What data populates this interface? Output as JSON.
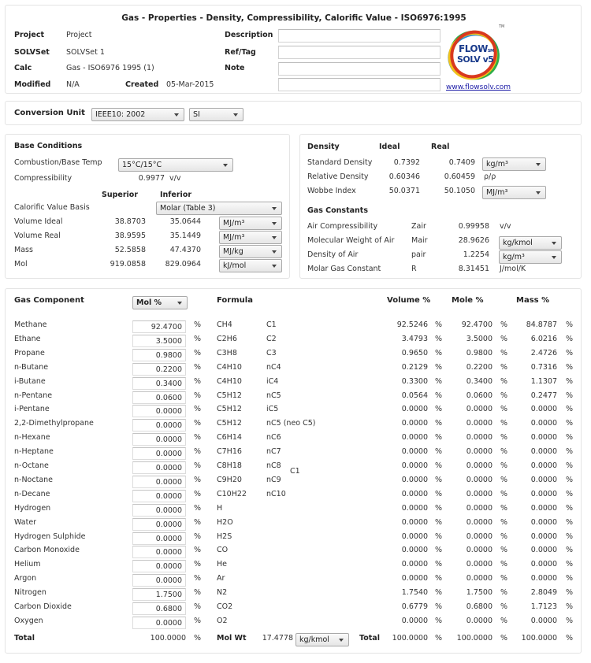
{
  "header": {
    "title": "Gas - Properties - Density, Compressibility, Calorific Value - ISO6976:1995",
    "project_label": "Project",
    "project_value": "Project",
    "solvset_label": "SOLVSet",
    "solvset_value": "SOLVSet 1",
    "calc_label": "Calc",
    "calc_value": "Gas - ISO6976 1995 (1)",
    "modified_label": "Modified",
    "modified_value": "N/A",
    "created_label": "Created",
    "created_value": "05-Mar-2015",
    "description_label": "Description",
    "description_value": "",
    "reftag_label": "Ref/Tag",
    "reftag_value": "",
    "note_label": "Note",
    "note_value": "",
    "extra_value": "",
    "logo_line1": "FLOW",
    "logo_sm": "SM",
    "logo_line2": "SOLV v5",
    "logo_tm": "TM",
    "website": "www.flowsolv.com"
  },
  "conversion": {
    "label": "Conversion Unit",
    "standard": "IEEE10: 2002",
    "system": "SI"
  },
  "base_conditions": {
    "title": "Base Conditions",
    "temp_label": "Combustion/Base Temp",
    "temp_value": "15°C/15°C",
    "compress_label": "Compressibility",
    "compress_value": "0.9977",
    "compress_unit": "v/v",
    "superior_header": "Superior",
    "inferior_header": "Inferior",
    "basis_label": "Calorific Value Basis",
    "basis_value": "Molar (Table 3)",
    "rows": [
      {
        "label": "Volume Ideal",
        "superior": "38.8703",
        "inferior": "35.0644",
        "unit": "MJ/m³"
      },
      {
        "label": "Volume Real",
        "superior": "38.9595",
        "inferior": "35.1449",
        "unit": "MJ/m³"
      },
      {
        "label": "Mass",
        "superior": "52.5858",
        "inferior": "47.4370",
        "unit": "MJ/kg"
      },
      {
        "label": "Mol",
        "superior": "919.0858",
        "inferior": "829.0964",
        "unit": "kJ/mol"
      }
    ]
  },
  "density": {
    "title": "Density",
    "ideal_header": "Ideal",
    "real_header": "Real",
    "rows": [
      {
        "label": "Standard Density",
        "ideal": "0.7392",
        "real": "0.7409",
        "unit": "kg/m³",
        "unit_select": true
      },
      {
        "label": "Relative Density",
        "ideal": "0.60346",
        "real": "0.60459",
        "unit": "ρ/ρ",
        "unit_select": false
      },
      {
        "label": "Wobbe Index",
        "ideal": "50.0371",
        "real": "50.1050",
        "unit": "MJ/m³",
        "unit_select": true
      }
    ]
  },
  "gas_constants": {
    "title": "Gas Constants",
    "rows": [
      {
        "label": "Air Compressibility",
        "symbol": "Zair",
        "value": "0.99958",
        "unit": "v/v"
      },
      {
        "label": "Molecular Weight of Air",
        "symbol": "Mair",
        "value": "28.9626",
        "unit": "kg/kmol"
      },
      {
        "label": "Density of Air",
        "symbol": "pair",
        "value": "1.2254",
        "unit": "kg/m³"
      },
      {
        "label": "Molar Gas Constant",
        "symbol": "R",
        "value": "8.31451",
        "unit": "J/mol/K"
      }
    ]
  },
  "components": {
    "title": "Gas Component",
    "basis": "Mol %",
    "formula_header": "Formula",
    "volume_header": "Volume %",
    "mole_header": "Mole %",
    "mass_header": "Mass %",
    "pct": "%",
    "group_label": "C1",
    "rows": [
      {
        "name": "Methane",
        "input": "92.4700",
        "formula": "CH4",
        "short": "C1",
        "volume": "92.5246",
        "mole": "92.4700",
        "mass": "84.8787"
      },
      {
        "name": "Ethane",
        "input": "3.5000",
        "formula": "C2H6",
        "short": "C2",
        "volume": "3.4793",
        "mole": "3.5000",
        "mass": "6.0216"
      },
      {
        "name": "Propane",
        "input": "0.9800",
        "formula": "C3H8",
        "short": "C3",
        "volume": "0.9650",
        "mole": "0.9800",
        "mass": "2.4726"
      },
      {
        "name": "n-Butane",
        "input": "0.2200",
        "formula": "C4H10",
        "short": "nC4",
        "volume": "0.2129",
        "mole": "0.2200",
        "mass": "0.7316"
      },
      {
        "name": "i-Butane",
        "input": "0.3400",
        "formula": "C4H10",
        "short": "iC4",
        "volume": "0.3300",
        "mole": "0.3400",
        "mass": "1.1307"
      },
      {
        "name": "n-Pentane",
        "input": "0.0600",
        "formula": "C5H12",
        "short": "nC5",
        "volume": "0.0564",
        "mole": "0.0600",
        "mass": "0.2477"
      },
      {
        "name": "i-Pentane",
        "input": "0.0000",
        "formula": "C5H12",
        "short": "iC5",
        "volume": "0.0000",
        "mole": "0.0000",
        "mass": "0.0000"
      },
      {
        "name": "2,2-Dimethylpropane",
        "input": "0.0000",
        "formula": "C5H12",
        "short": "nC5 (neo C5)",
        "volume": "0.0000",
        "mole": "0.0000",
        "mass": "0.0000"
      },
      {
        "name": "n-Hexane",
        "input": "0.0000",
        "formula": "C6H14",
        "short": "nC6",
        "volume": "0.0000",
        "mole": "0.0000",
        "mass": "0.0000"
      },
      {
        "name": "n-Heptane",
        "input": "0.0000",
        "formula": "C7H16",
        "short": "nC7",
        "volume": "0.0000",
        "mole": "0.0000",
        "mass": "0.0000"
      },
      {
        "name": "n-Octane",
        "input": "0.0000",
        "formula": "C8H18",
        "short": "nC8",
        "volume": "0.0000",
        "mole": "0.0000",
        "mass": "0.0000"
      },
      {
        "name": "n-Noctane",
        "input": "0.0000",
        "formula": "C9H20",
        "short": "nC9",
        "volume": "0.0000",
        "mole": "0.0000",
        "mass": "0.0000"
      },
      {
        "name": "n-Decane",
        "input": "0.0000",
        "formula": "C10H22",
        "short": "nC10",
        "volume": "0.0000",
        "mole": "0.0000",
        "mass": "0.0000"
      },
      {
        "name": "Hydrogen",
        "input": "0.0000",
        "formula": "H",
        "short": "",
        "volume": "0.0000",
        "mole": "0.0000",
        "mass": "0.0000"
      },
      {
        "name": "Water",
        "input": "0.0000",
        "formula": "H2O",
        "short": "",
        "volume": "0.0000",
        "mole": "0.0000",
        "mass": "0.0000"
      },
      {
        "name": "Hydrogen Sulphide",
        "input": "0.0000",
        "formula": "H2S",
        "short": "",
        "volume": "0.0000",
        "mole": "0.0000",
        "mass": "0.0000"
      },
      {
        "name": "Carbon Monoxide",
        "input": "0.0000",
        "formula": "CO",
        "short": "",
        "volume": "0.0000",
        "mole": "0.0000",
        "mass": "0.0000"
      },
      {
        "name": "Helium",
        "input": "0.0000",
        "formula": "He",
        "short": "",
        "volume": "0.0000",
        "mole": "0.0000",
        "mass": "0.0000"
      },
      {
        "name": "Argon",
        "input": "0.0000",
        "formula": "Ar",
        "short": "",
        "volume": "0.0000",
        "mole": "0.0000",
        "mass": "0.0000"
      },
      {
        "name": "Nitrogen",
        "input": "1.7500",
        "formula": "N2",
        "short": "",
        "volume": "1.7540",
        "mole": "1.7500",
        "mass": "2.8049"
      },
      {
        "name": "Carbon Dioxide",
        "input": "0.6800",
        "formula": "CO2",
        "short": "",
        "volume": "0.6779",
        "mole": "0.6800",
        "mass": "1.7123"
      },
      {
        "name": "Oxygen",
        "input": "0.0000",
        "formula": "O2",
        "short": "",
        "volume": "0.0000",
        "mole": "0.0000",
        "mass": "0.0000"
      }
    ],
    "total_label": "Total",
    "total_input": "100.0000",
    "molwt_label": "Mol Wt",
    "molwt_value": "17.4778",
    "molwt_unit": "kg/kmol",
    "total2_label": "Total",
    "total_volume": "100.0000",
    "total_mole": "100.0000",
    "total_mass": "100.0000"
  }
}
